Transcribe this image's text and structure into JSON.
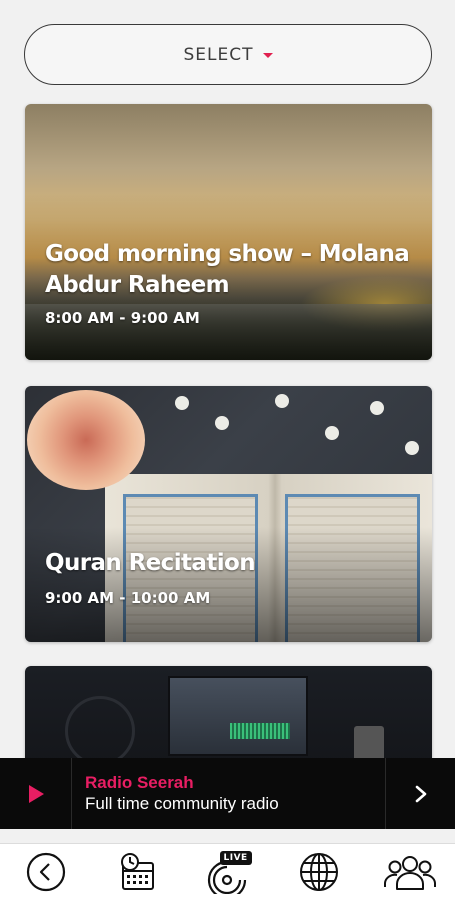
{
  "select": {
    "label": "SELECT"
  },
  "shows": [
    {
      "title": "Good morning show – Molana Abdur Raheem",
      "time": "8:00 AM - 9:00 AM"
    },
    {
      "title": "Quran Recitation",
      "time": "9:00 AM - 10:00 AM"
    },
    {
      "title": "",
      "time": ""
    }
  ],
  "player": {
    "station": "Radio Seerah",
    "tagline": "Full time community radio"
  },
  "nav": {
    "items": [
      {
        "icon": "back-icon"
      },
      {
        "icon": "schedule-icon"
      },
      {
        "icon": "live-icon",
        "badge": "LIVE"
      },
      {
        "icon": "globe-icon"
      },
      {
        "icon": "community-icon"
      }
    ]
  },
  "colors": {
    "accent": "#e81e63",
    "player_bg": "#0a0a0a",
    "background": "#f1f1f1"
  }
}
